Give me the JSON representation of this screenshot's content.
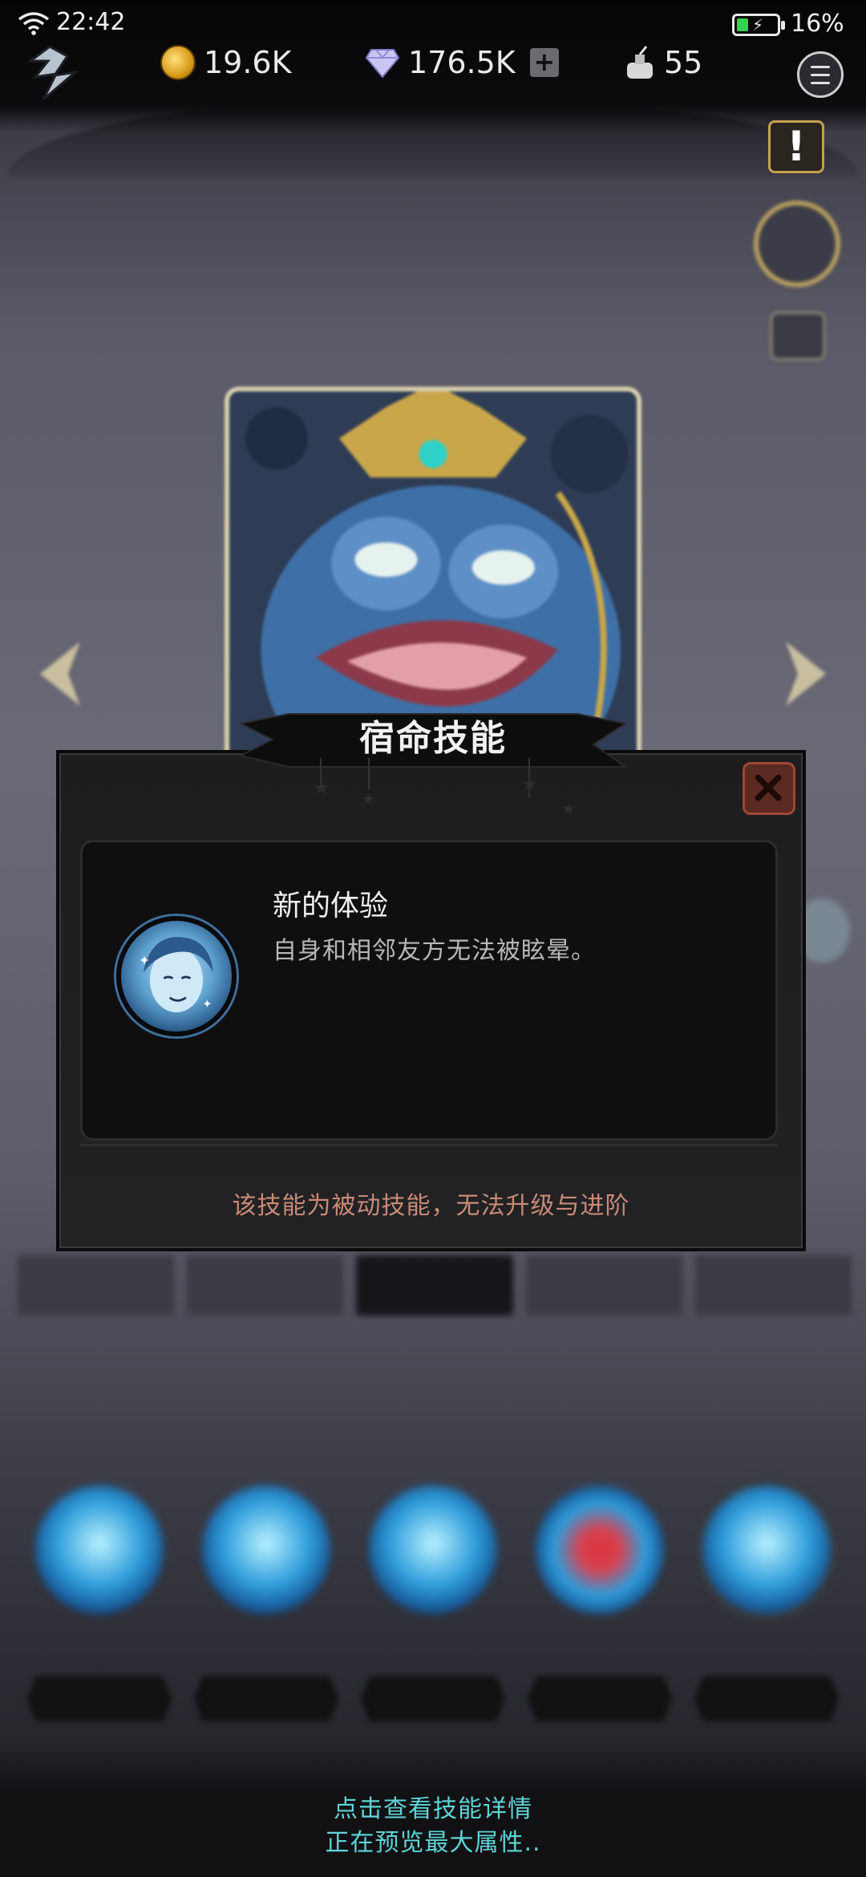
{
  "status_bar": {
    "time": "22:42",
    "battery_percent": "16%",
    "battery_level": 0.16,
    "charging": true
  },
  "resources": {
    "gold": {
      "icon": "coin-icon",
      "value": "19.6K"
    },
    "gems": {
      "icon": "diamond-icon",
      "value": "176.5K",
      "plus": "+"
    },
    "ink": {
      "icon": "ink-bottle-icon",
      "value": "55"
    }
  },
  "alert_button": {
    "label": "!"
  },
  "modal": {
    "title": "宿命技能",
    "skill": {
      "name": "新的体验",
      "description": "自身和相邻友方无法被眩晕。"
    },
    "note": "该技能为被动技能，无法升级与进阶"
  },
  "hints": {
    "line1": "点击查看技能详情",
    "line2": "正在预览最大属性.."
  },
  "colors": {
    "accent_gold": "#c7a04c",
    "note_text": "#c98a76",
    "hint_text": "#5fd4d6",
    "close_red": "#5b2a22"
  }
}
